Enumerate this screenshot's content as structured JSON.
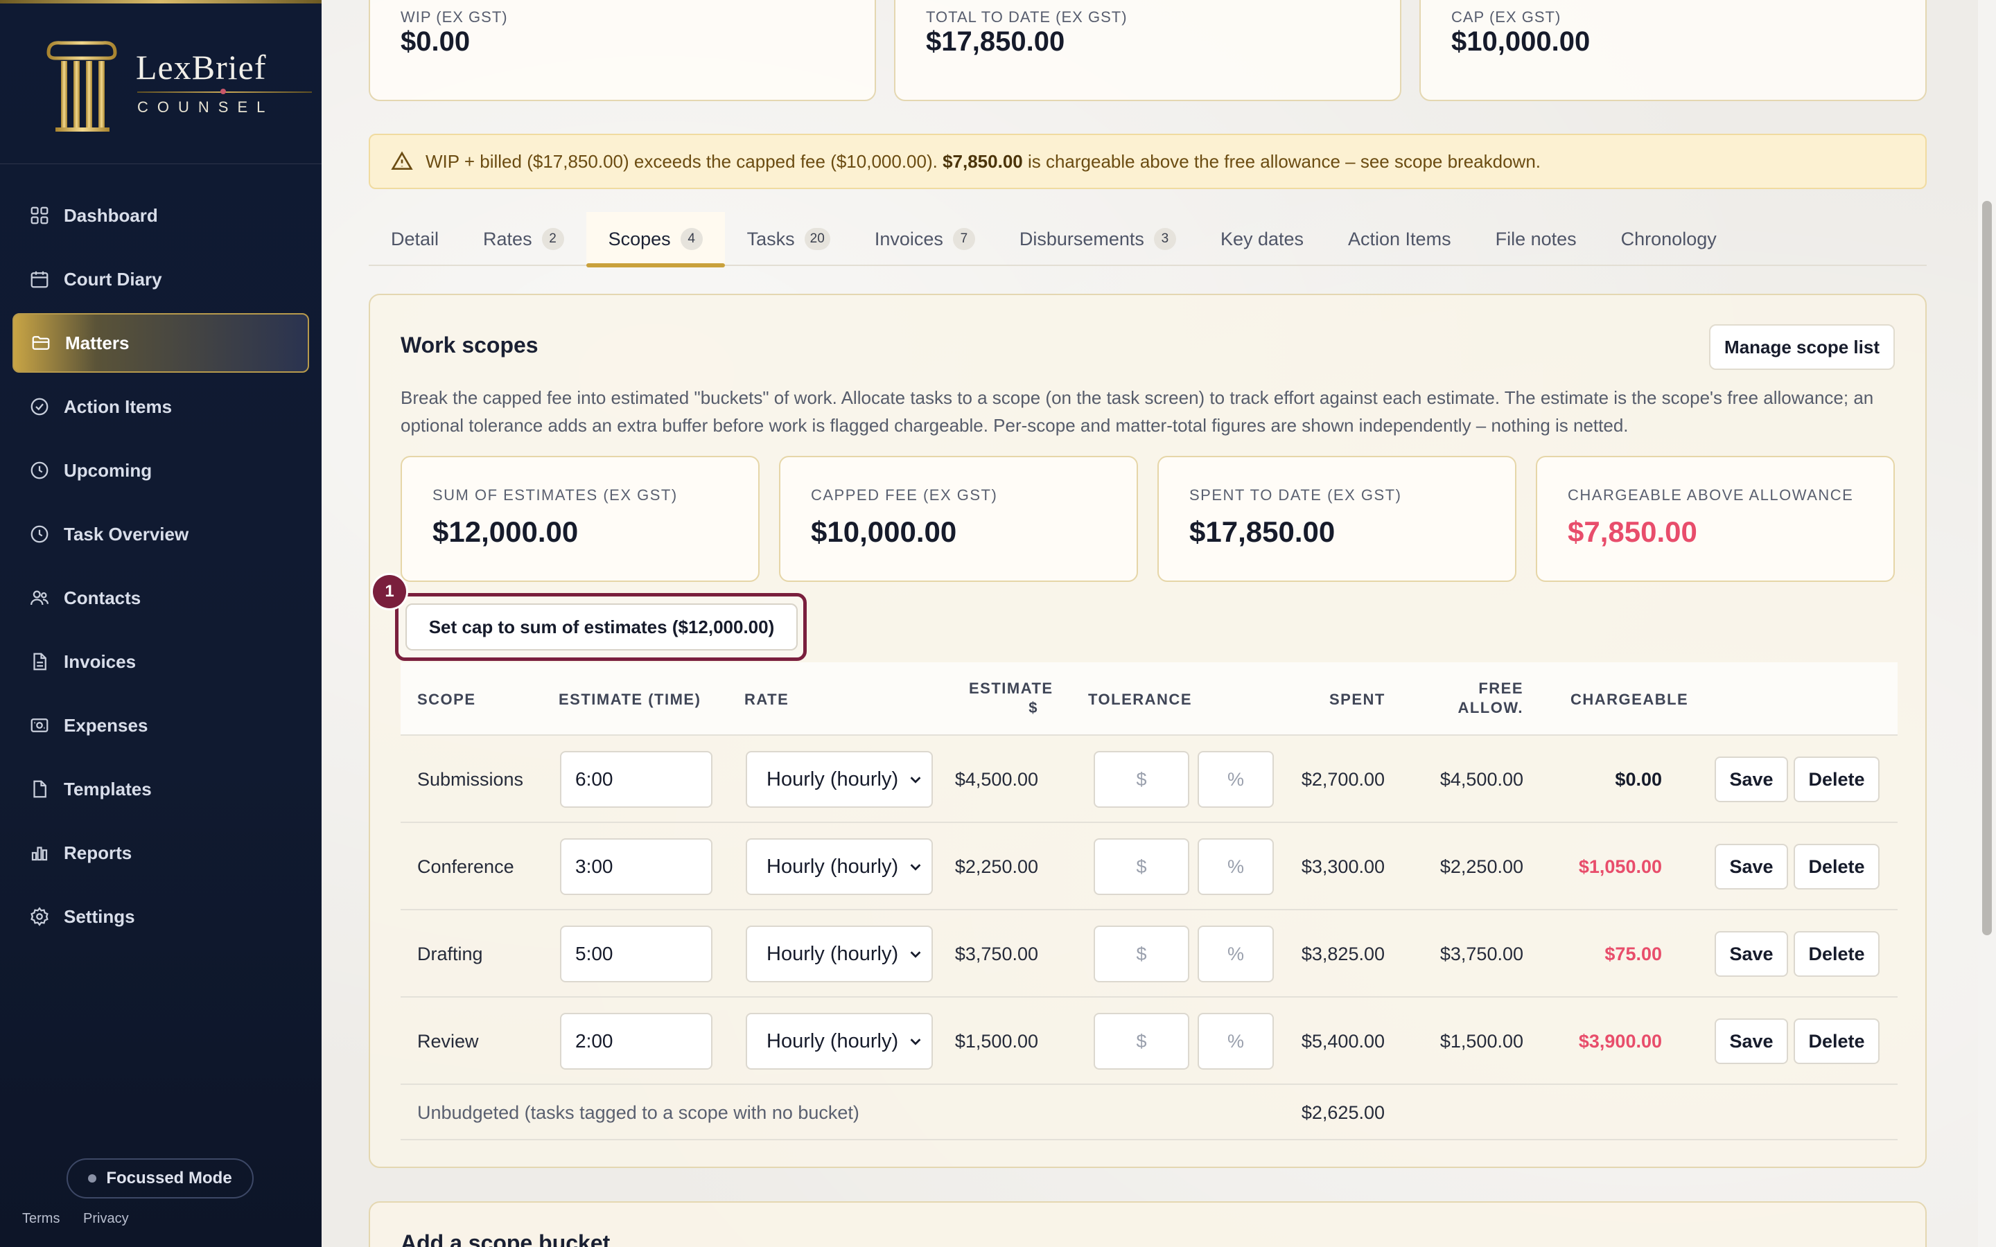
{
  "brand": {
    "name": "LexBrief",
    "sub": "COUNSEL"
  },
  "nav": [
    {
      "label": "Dashboard",
      "icon": "grid-icon"
    },
    {
      "label": "Court Diary",
      "icon": "calendar-icon"
    },
    {
      "label": "Matters",
      "icon": "folder-icon",
      "active": true
    },
    {
      "label": "Action Items",
      "icon": "check-circle-icon"
    },
    {
      "label": "Upcoming",
      "icon": "clock-icon"
    },
    {
      "label": "Task Overview",
      "icon": "clock-icon"
    },
    {
      "label": "Contacts",
      "icon": "users-icon"
    },
    {
      "label": "Invoices",
      "icon": "file-icon"
    },
    {
      "label": "Expenses",
      "icon": "receipt-icon"
    },
    {
      "label": "Templates",
      "icon": "file-icon"
    },
    {
      "label": "Reports",
      "icon": "bar-chart-icon"
    },
    {
      "label": "Settings",
      "icon": "gear-icon"
    }
  ],
  "focus_mode": "Focussed Mode",
  "legal": {
    "terms": "Terms",
    "privacy": "Privacy"
  },
  "summary": [
    {
      "label": "WIP (EX GST)",
      "value": "$0.00"
    },
    {
      "label": "TOTAL TO DATE (EX GST)",
      "value": "$17,850.00"
    },
    {
      "label": "CAP (EX GST)",
      "value": "$10,000.00"
    }
  ],
  "alert": {
    "part1": "WIP + billed ($17,850.00) exceeds the capped fee ($10,000.00). ",
    "amount": "$7,850.00",
    "part2": " is chargeable above the free allowance – see scope breakdown."
  },
  "tabs": [
    {
      "label": "Detail"
    },
    {
      "label": "Rates",
      "count": "2"
    },
    {
      "label": "Scopes",
      "count": "4",
      "active": true
    },
    {
      "label": "Tasks",
      "count": "20"
    },
    {
      "label": "Invoices",
      "count": "7"
    },
    {
      "label": "Disbursements",
      "count": "3"
    },
    {
      "label": "Key dates"
    },
    {
      "label": "Action Items"
    },
    {
      "label": "File notes"
    },
    {
      "label": "Chronology"
    }
  ],
  "scopes": {
    "title": "Work scopes",
    "manage_label": "Manage scope list",
    "description": "Break the capped fee into estimated \"buckets\" of work. Allocate tasks to a scope (on the task screen) to track effort against each estimate. The estimate is the scope's free allowance; an optional tolerance adds an extra buffer before work is flagged chargeable. Per-scope and matter-total figures are shown independently – nothing is netted.",
    "stats": [
      {
        "label": "SUM OF ESTIMATES (EX GST)",
        "value": "$12,000.00"
      },
      {
        "label": "CAPPED FEE (EX GST)",
        "value": "$10,000.00"
      },
      {
        "label": "SPENT TO DATE (EX GST)",
        "value": "$17,850.00"
      },
      {
        "label": "CHARGEABLE ABOVE ALLOWANCE",
        "value": "$7,850.00",
        "highlight": "#e84d6b"
      }
    ],
    "set_cap_label": "Set cap to sum of estimates ($12,000.00)",
    "marker": "1",
    "columns": {
      "scope": "SCOPE",
      "estimate_time": "ESTIMATE (TIME)",
      "rate": "RATE",
      "estimate_dollar_1": "ESTIMATE",
      "estimate_dollar_2": "$",
      "tolerance": "TOLERANCE",
      "spent": "SPENT",
      "free_1": "FREE",
      "free_2": "ALLOW.",
      "chargeable": "CHARGEABLE"
    },
    "rows": [
      {
        "scope": "Submissions",
        "time": "6:00",
        "rate": "Hourly (hourly)",
        "estimate": "$4,500.00",
        "tol_dollar": "$",
        "tol_pct": "%",
        "spent": "$2,700.00",
        "free": "$4,500.00",
        "chargeable": "$0.00",
        "chargeable_red": false
      },
      {
        "scope": "Conference",
        "time": "3:00",
        "rate": "Hourly (hourly)",
        "estimate": "$2,250.00",
        "tol_dollar": "$",
        "tol_pct": "%",
        "spent": "$3,300.00",
        "free": "$2,250.00",
        "chargeable": "$1,050.00",
        "chargeable_red": true
      },
      {
        "scope": "Drafting",
        "time": "5:00",
        "rate": "Hourly (hourly)",
        "estimate": "$3,750.00",
        "tol_dollar": "$",
        "tol_pct": "%",
        "spent": "$3,825.00",
        "free": "$3,750.00",
        "chargeable": "$75.00",
        "chargeable_red": true
      },
      {
        "scope": "Review",
        "time": "2:00",
        "rate": "Hourly (hourly)",
        "estimate": "$1,500.00",
        "tol_dollar": "$",
        "tol_pct": "%",
        "spent": "$5,400.00",
        "free": "$1,500.00",
        "chargeable": "$3,900.00",
        "chargeable_red": true
      }
    ],
    "save_label": "Save",
    "delete_label": "Delete",
    "unbudgeted": {
      "label": "Unbudgeted (tasks tagged to a scope with no bucket)",
      "spent": "$2,625.00"
    }
  },
  "add_bucket_title": "Add a scope bucket"
}
